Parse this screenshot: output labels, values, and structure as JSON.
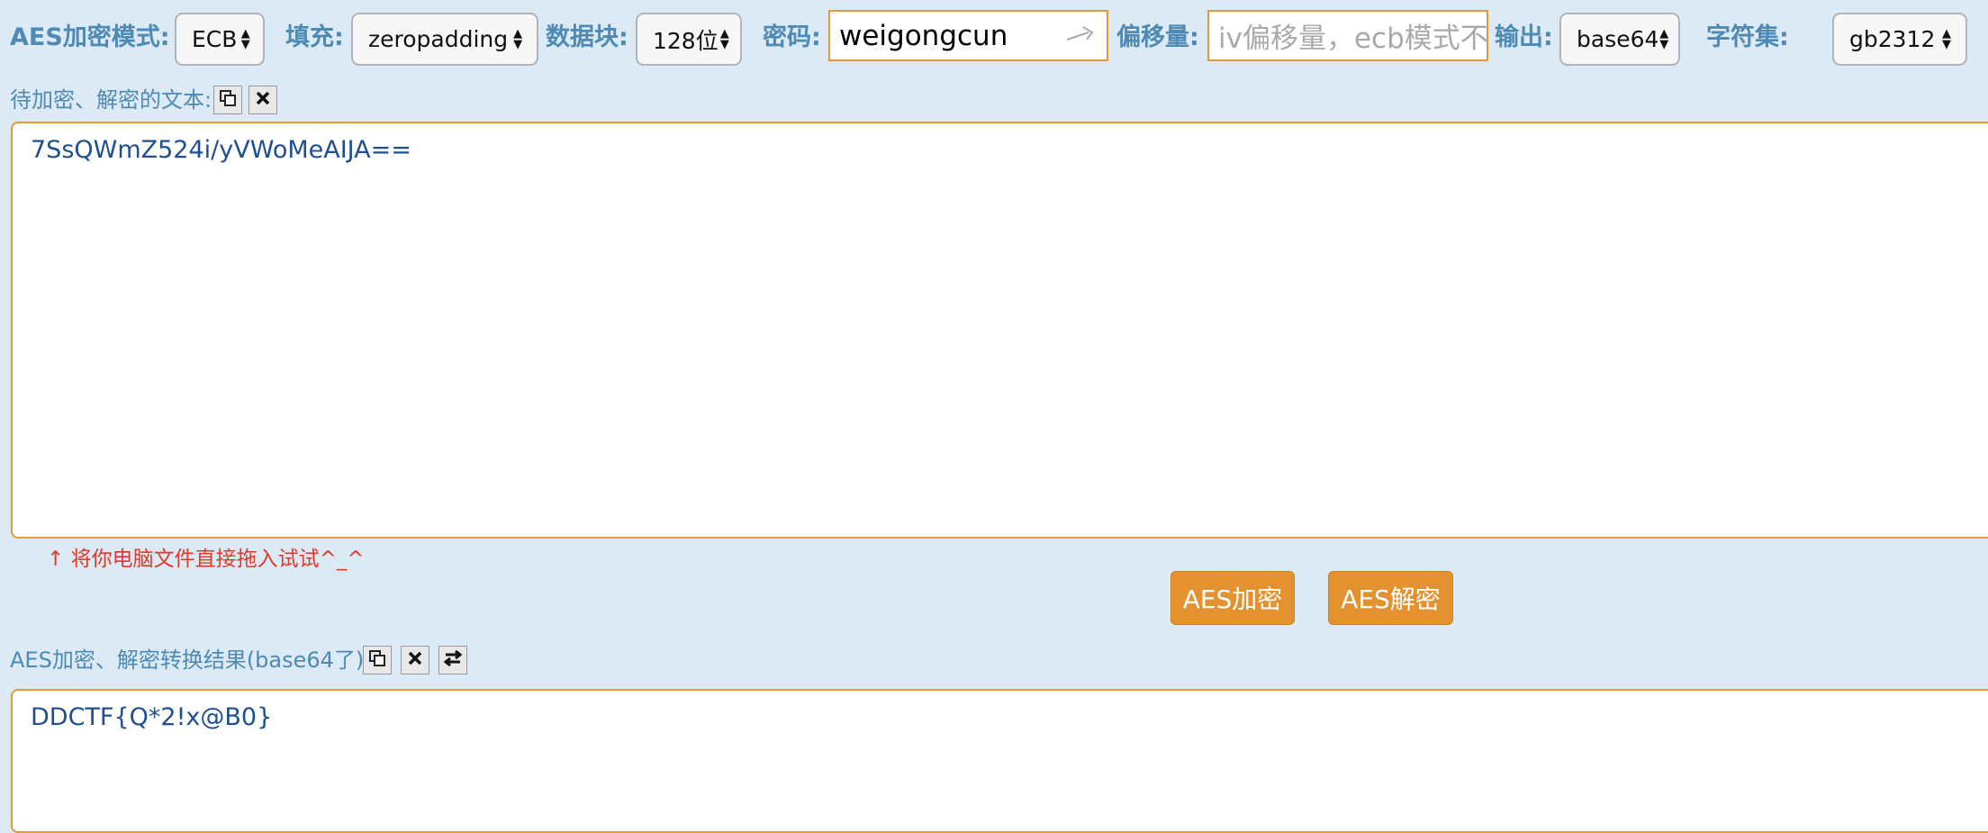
{
  "toolbar": {
    "mode_label": "AES加密模式:",
    "mode_value": "ECB",
    "padding_label": "填充:",
    "padding_value": "zeropadding",
    "block_label": "数据块:",
    "block_value": "128位",
    "password_label": "密码:",
    "password_value": "weigongcun",
    "offset_label": "偏移量:",
    "offset_placeholder": "iv偏移量，ecb模式不用填写",
    "output_label": "输出:",
    "output_value": "base64",
    "charset_label": "字符集:",
    "charset_value": "gb2312"
  },
  "input_section": {
    "label": "待加密、解密的文本:",
    "text": "7SsQWmZ524i/yVWoMeAIJA==",
    "hint": "↑ 将你电脑文件直接拖入试试^_^"
  },
  "actions": {
    "encrypt_label": "AES加密",
    "decrypt_label": "AES解密"
  },
  "output_section": {
    "label": "AES加密、解密转换结果(base64了):",
    "text": "DDCTF{Q*2!x@B0}"
  },
  "icons": [
    "copy-icon",
    "clear-icon",
    "swap-icon"
  ],
  "colors": {
    "accent": "#e3922f",
    "label": "#4e8ab3",
    "background": "#dbeaf5",
    "text": "#1f4f92"
  }
}
